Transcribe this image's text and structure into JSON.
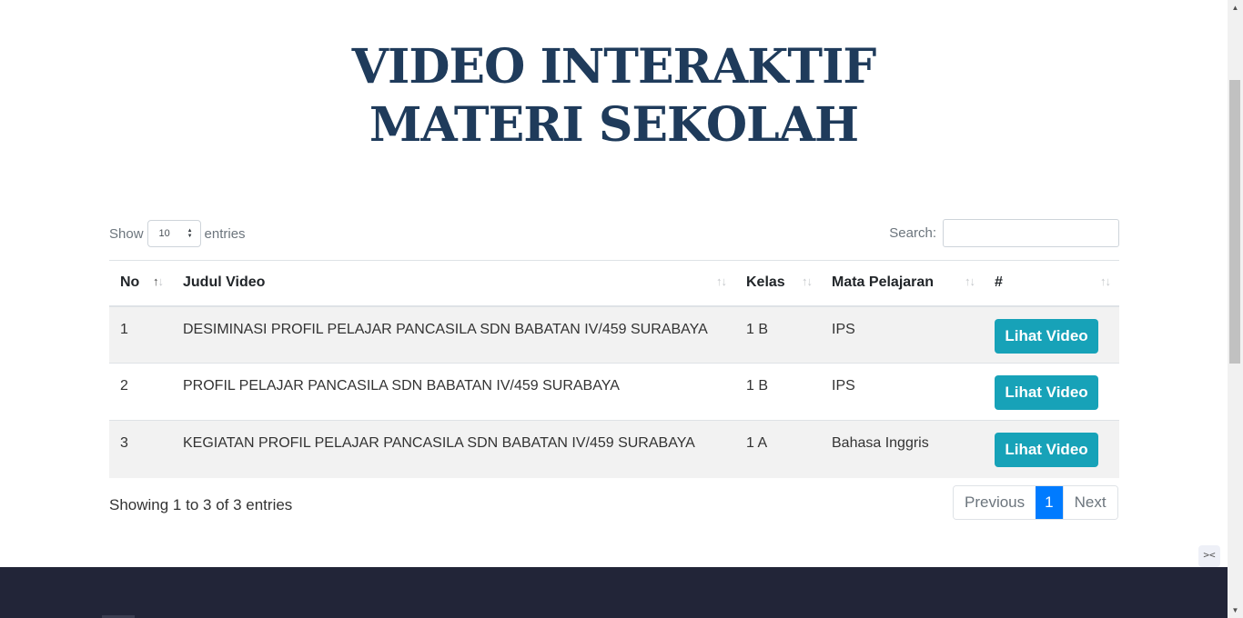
{
  "hero": {
    "title_line1": "VIDEO INTERAKTIF",
    "title_line2": "MATERI SEKOLAH"
  },
  "length": {
    "show_label": "Show",
    "value": "10",
    "entries_label": "entries"
  },
  "search": {
    "label": "Search:",
    "value": "",
    "placeholder": ""
  },
  "table": {
    "columns": [
      "No",
      "Judul Video",
      "Kelas",
      "Mata Pelajaran",
      "#"
    ],
    "rows": [
      {
        "no": "1",
        "judul": "DESIMINASI PROFIL PELAJAR PANCASILA SDN BABATAN IV/459 SURABAYA",
        "kelas": "1 B",
        "mapel": "IPS",
        "action": "Lihat Video"
      },
      {
        "no": "2",
        "judul": "PROFIL PELAJAR PANCASILA SDN BABATAN IV/459 SURABAYA",
        "kelas": "1 B",
        "mapel": "IPS",
        "action": "Lihat Video"
      },
      {
        "no": "3",
        "judul": "KEGIATAN PROFIL PELAJAR PANCASILA SDN BABATAN IV/459 SURABAYA",
        "kelas": "1 A",
        "mapel": "Bahasa Inggris",
        "action": "Lihat Video"
      }
    ]
  },
  "info": "Showing 1 to 3 of 3 entries",
  "pagination": {
    "previous": "Previous",
    "current": "1",
    "next": "Next"
  },
  "icons": {
    "sort": "sort-arrows-icon",
    "toggle": "code-toggle-icon"
  },
  "colors": {
    "title": "#1f3b5b",
    "button": "#17a2b8",
    "active_page": "#007bff",
    "footer": "#222538"
  }
}
